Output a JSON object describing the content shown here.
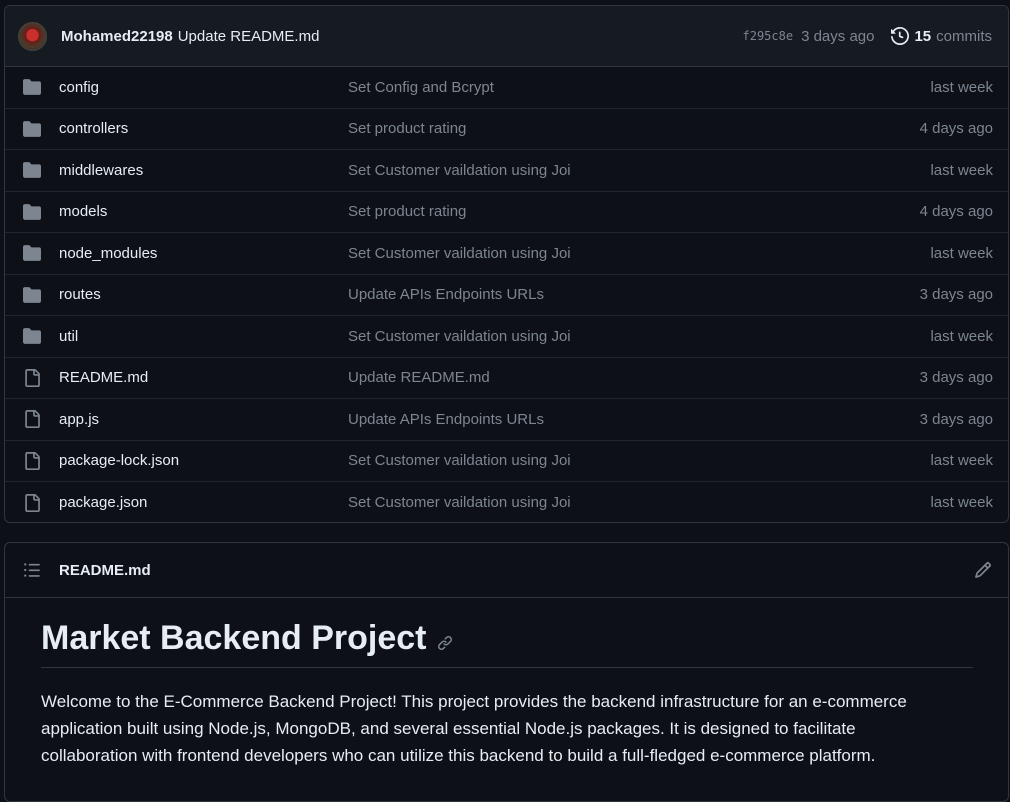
{
  "latest_commit": {
    "author": "Mohamed22198",
    "message": "Update README.md",
    "sha": "f295c8e",
    "time": "3 days ago",
    "commits_count": "15",
    "commits_label": "commits"
  },
  "files": [
    {
      "name": "config",
      "type": "folder",
      "commit": "Set Config and Bcrypt",
      "time": "last week"
    },
    {
      "name": "controllers",
      "type": "folder",
      "commit": "Set product rating",
      "time": "4 days ago"
    },
    {
      "name": "middlewares",
      "type": "folder",
      "commit": "Set Customer vaildation using Joi",
      "time": "last week"
    },
    {
      "name": "models",
      "type": "folder",
      "commit": "Set product rating",
      "time": "4 days ago"
    },
    {
      "name": "node_modules",
      "type": "folder",
      "commit": "Set Customer vaildation using Joi",
      "time": "last week"
    },
    {
      "name": "routes",
      "type": "folder",
      "commit": "Update APIs Endpoints URLs",
      "time": "3 days ago"
    },
    {
      "name": "util",
      "type": "folder",
      "commit": "Set Customer vaildation using Joi",
      "time": "last week"
    },
    {
      "name": "README.md",
      "type": "file",
      "commit": "Update README.md",
      "time": "3 days ago"
    },
    {
      "name": "app.js",
      "type": "file",
      "commit": "Update APIs Endpoints URLs",
      "time": "3 days ago"
    },
    {
      "name": "package-lock.json",
      "type": "file",
      "commit": "Set Customer vaildation using Joi",
      "time": "last week"
    },
    {
      "name": "package.json",
      "type": "file",
      "commit": "Set Customer vaildation using Joi",
      "time": "last week"
    }
  ],
  "readme": {
    "filename": "README.md",
    "heading": "Market Backend Project",
    "paragraph_lines": [
      "Welcome to the E-Commerce Backend Project! This project provides the backend infrastructure for an e-commerce",
      "application built using Node.js, MongoDB, and several essential Node.js packages. It is designed to facilitate",
      "collaboration with frontend developers who can utilize this backend to build a full-fledged e-commerce platform."
    ]
  },
  "icons": {
    "folder": "folder-icon",
    "file": "file-icon",
    "history": "history-icon",
    "list": "list-icon",
    "edit": "pencil-icon",
    "anchor": "link-icon"
  },
  "colors": {
    "background": "#0d1117",
    "header_bg": "#161b22",
    "border": "#30363d",
    "text": "#e6edf3",
    "muted": "#7d8590",
    "icon": "#7d8590"
  }
}
